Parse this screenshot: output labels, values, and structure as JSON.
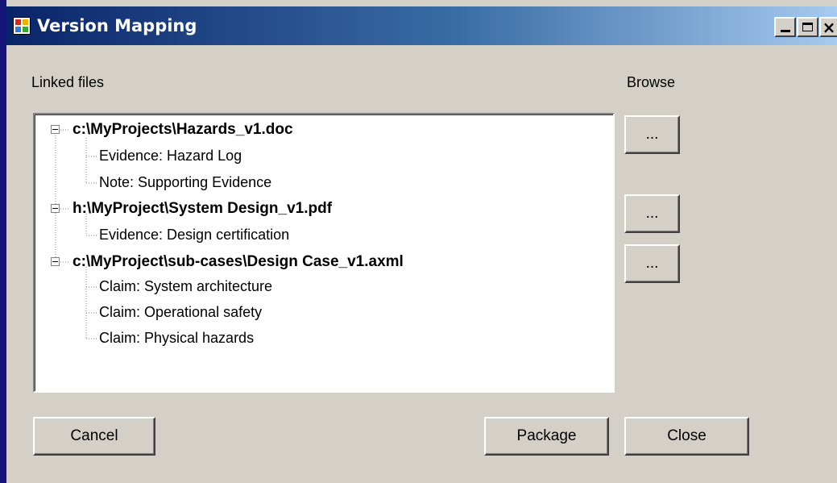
{
  "window": {
    "title": "Version Mapping",
    "controls": {
      "minimize": "minimize",
      "maximize": "maximize",
      "close": "close"
    }
  },
  "labels": {
    "linked_files": "Linked files",
    "browse": "Browse"
  },
  "tree": {
    "nodes": [
      {
        "label": "c:\\MyProjects\\Hazards_v1.doc",
        "expanded": true,
        "children": [
          "Evidence: Hazard Log",
          "Note: Supporting Evidence"
        ]
      },
      {
        "label": "h:\\MyProject\\System Design_v1.pdf",
        "expanded": true,
        "children": [
          "Evidence: Design certification"
        ]
      },
      {
        "label": "c:\\MyProject\\sub-cases\\Design Case_v1.axml",
        "expanded": true,
        "children": [
          "Claim: System architecture",
          "Claim: Operational safety",
          "Claim: Physical hazards"
        ]
      }
    ]
  },
  "browse_buttons": [
    "...",
    "...",
    "..."
  ],
  "buttons": {
    "cancel": "Cancel",
    "package": "Package",
    "close": "Close"
  }
}
